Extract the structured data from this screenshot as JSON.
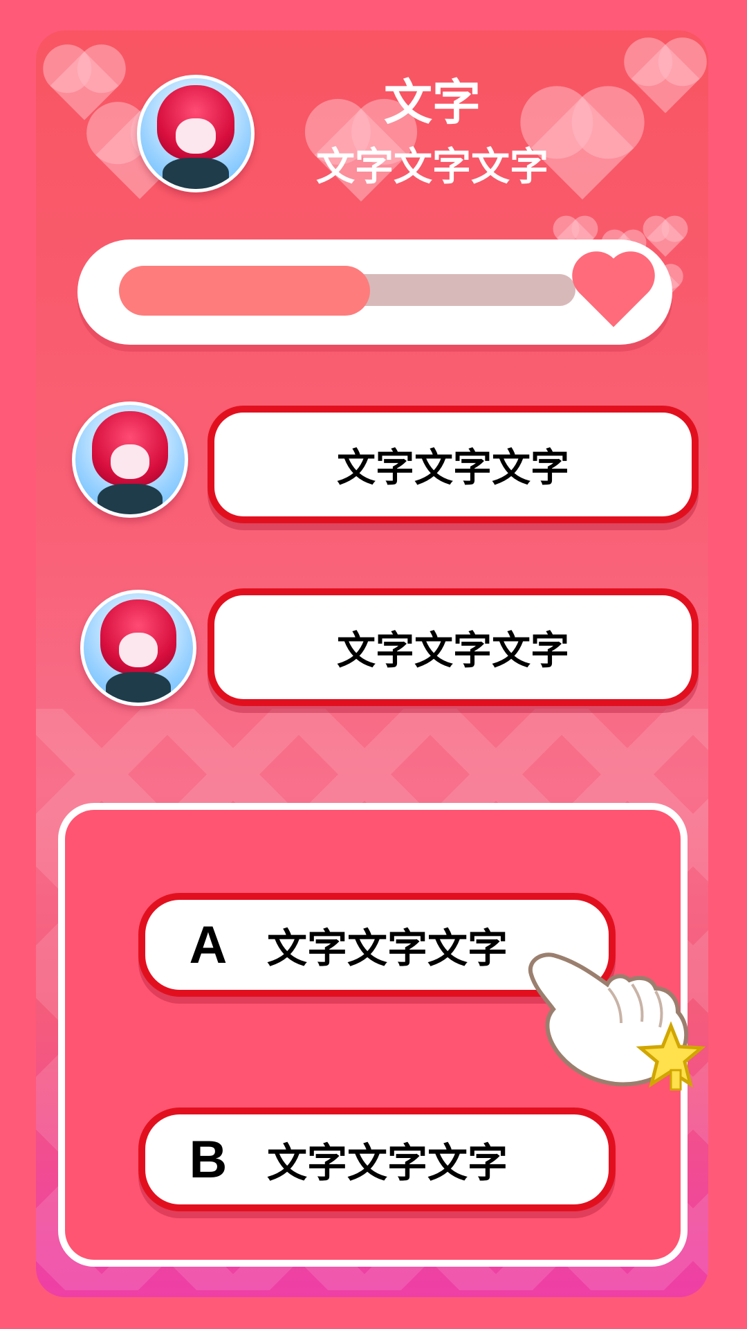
{
  "header": {
    "title": "文字",
    "subtitle": "文字文字文字"
  },
  "progress": {
    "fraction": 0.55
  },
  "chat": {
    "messages": [
      {
        "text": "文字文字文字"
      },
      {
        "text": "文字文字文字"
      }
    ]
  },
  "options": [
    {
      "letter": "A",
      "text": "文字文字文字"
    },
    {
      "letter": "B",
      "text": "文字文字文字"
    }
  ],
  "colors": {
    "background": "#ff5a78",
    "accent_red": "#e2101f",
    "progress_fill": "#ff7c7c"
  },
  "icons": {
    "hearts": "heart-icon",
    "pointer": "pointing-hand-icon"
  }
}
